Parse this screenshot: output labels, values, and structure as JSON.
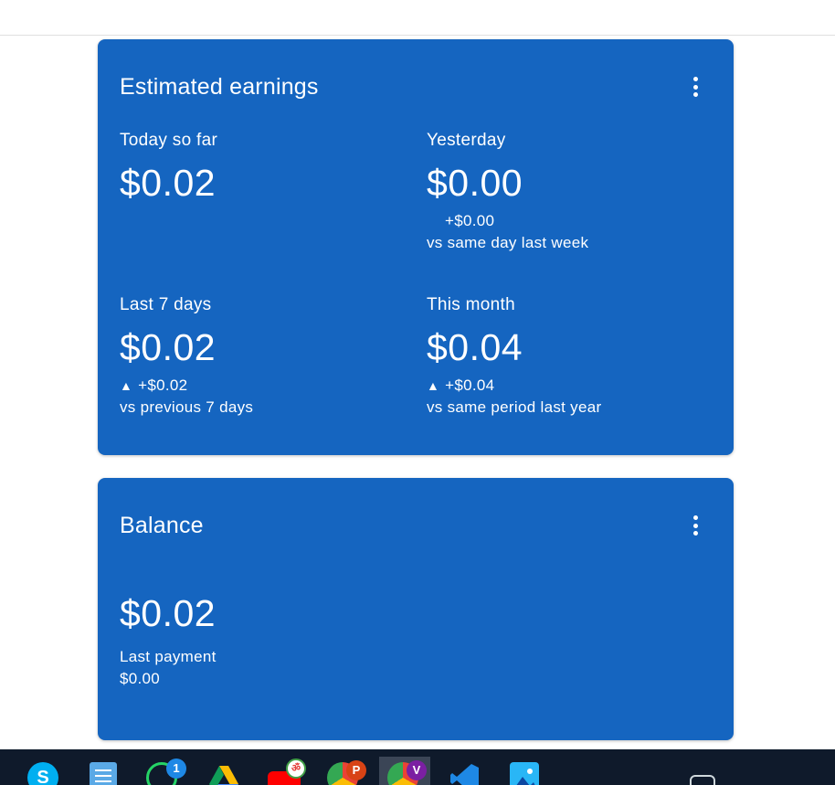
{
  "earnings_card": {
    "title": "Estimated earnings",
    "today": {
      "label": "Today so far",
      "value": "$0.02"
    },
    "yesterday": {
      "label": "Yesterday",
      "value": "$0.00",
      "delta": "+$0.00",
      "delta_note": "vs same day last week"
    },
    "last7": {
      "label": "Last 7 days",
      "value": "$0.02",
      "delta_icon": "▲",
      "delta": "+$0.02",
      "delta_note": "vs previous 7 days"
    },
    "month": {
      "label": "This month",
      "value": "$0.04",
      "delta_icon": "▲",
      "delta": "+$0.04",
      "delta_note": "vs same period last year"
    }
  },
  "balance_card": {
    "title": "Balance",
    "value": "$0.02",
    "last_payment_label": "Last payment",
    "last_payment_value": "$0.00"
  },
  "taskbar": {
    "whatsapp_badge": "1",
    "app_p_badge": "P",
    "app_v_badge": "V",
    "icons": [
      "skype-icon",
      "notepad-icon",
      "whatsapp-icon",
      "google-drive-icon",
      "youtube-icon",
      "chrome-profile-p-icon",
      "chrome-profile-v-icon",
      "vscode-icon",
      "photos-icon"
    ]
  },
  "colors": {
    "card_bg": "#1565c0",
    "text": "#ffffff",
    "taskbar_bg": "#0f1a2b"
  }
}
